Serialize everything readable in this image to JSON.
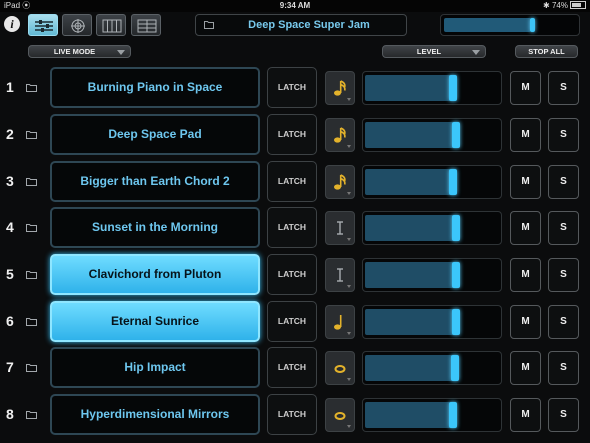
{
  "status_bar": {
    "device": "iPad",
    "time": "9:34 AM",
    "battery": "74%"
  },
  "toolbar": {
    "info_label": "i",
    "song_title": "Deep Space Super Jam",
    "master_level": 0.68,
    "view_buttons": [
      "mixer-view",
      "target-view",
      "keyboard-view",
      "grid-view"
    ],
    "active_view": 0
  },
  "controls": {
    "live_mode_label": "LIVE MODE",
    "level_label": "LEVEL",
    "stop_all_label": "STOP ALL"
  },
  "rows": [
    {
      "number": "1",
      "name": "Burning Piano in Space",
      "latch": "LATCH",
      "quantize": "sixteenth-note",
      "level": 0.68,
      "active": false,
      "mute": "M",
      "solo": "S"
    },
    {
      "number": "2",
      "name": "Deep Space Pad",
      "latch": "LATCH",
      "quantize": "sixteenth-note",
      "level": 0.7,
      "active": false,
      "mute": "M",
      "solo": "S"
    },
    {
      "number": "3",
      "name": "Bigger than Earth Chord 2",
      "latch": "LATCH",
      "quantize": "sixteenth-note",
      "level": 0.68,
      "active": false,
      "mute": "M",
      "solo": "S"
    },
    {
      "number": "4",
      "name": "Sunset in the Morning",
      "latch": "LATCH",
      "quantize": "none",
      "level": 0.7,
      "active": false,
      "mute": "M",
      "solo": "S"
    },
    {
      "number": "5",
      "name": "Clavichord from Pluton",
      "latch": "LATCH",
      "quantize": "none",
      "level": 0.7,
      "active": true,
      "mute": "M",
      "solo": "S"
    },
    {
      "number": "6",
      "name": "Eternal Sunrice",
      "latch": "LATCH",
      "quantize": "eighth-note",
      "level": 0.7,
      "active": true,
      "mute": "M",
      "solo": "S"
    },
    {
      "number": "7",
      "name": "Hip Impact",
      "latch": "LATCH",
      "quantize": "whole-note",
      "level": 0.69,
      "active": false,
      "mute": "M",
      "solo": "S"
    },
    {
      "number": "8",
      "name": "Hyperdimensional Mirrors",
      "latch": "LATCH",
      "quantize": "whole-note",
      "level": 0.68,
      "active": false,
      "mute": "M",
      "solo": "S"
    }
  ],
  "colors": {
    "accent": "#3bc6fb",
    "slot_text": "#6ec7ef",
    "note_icon": "#e3b22b"
  }
}
